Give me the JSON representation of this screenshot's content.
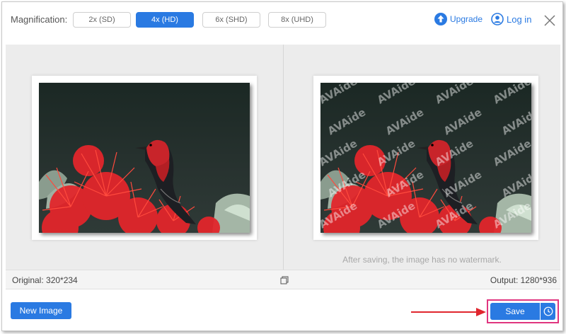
{
  "header": {
    "magnification_label": "Magnification:",
    "options": [
      {
        "label": "2x (SD)",
        "selected": false
      },
      {
        "label": "4x (HD)",
        "selected": true
      },
      {
        "label": "6x (SHD)",
        "selected": false
      },
      {
        "label": "8x (UHD)",
        "selected": false
      }
    ],
    "upgrade_label": "Upgrade",
    "login_label": "Log in"
  },
  "preview": {
    "watermark_text": "AVAide",
    "no_watermark_note": "After saving, the image has no watermark."
  },
  "info": {
    "original": "Original: 320*234",
    "output": "Output: 1280*936"
  },
  "footer": {
    "new_image_label": "New Image",
    "save_label": "Save"
  },
  "colors": {
    "accent": "#2a7ae2",
    "highlight": "#e0357f",
    "annotation_arrow": "#e0262e"
  }
}
